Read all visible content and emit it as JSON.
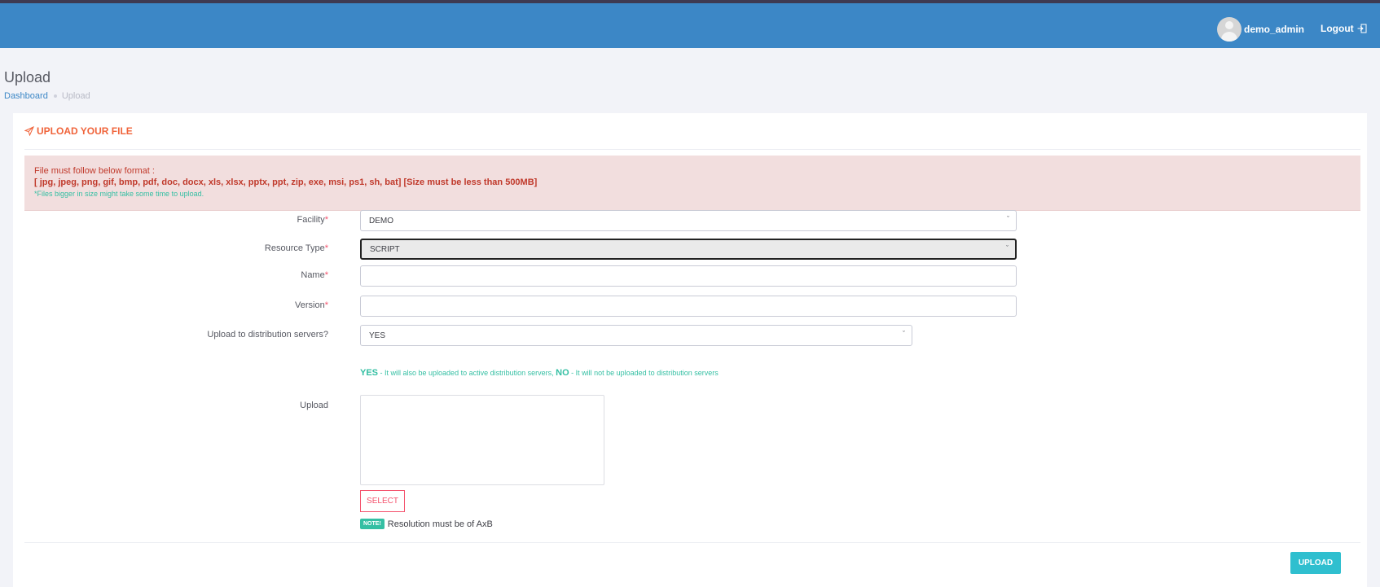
{
  "header": {
    "username": "demo_admin",
    "logout_label": "Logout"
  },
  "page": {
    "title": "Upload",
    "breadcrumb": [
      "Dashboard",
      "Upload"
    ]
  },
  "card": {
    "title": "UPLOAD YOUR FILE",
    "alert": {
      "line1": "File must follow below format :",
      "line2": "[ jpg, jpeg, png, gif, bmp, pdf, doc, docx, xls, xlsx, pptx, ppt, zip, exe, msi, ps1, sh, bat] [Size must be less than 500MB]",
      "line3": "*Files bigger in size might take some time to upload."
    },
    "form": {
      "facility": {
        "label": "Facility",
        "required": "*",
        "value": "DEMO"
      },
      "resource_type": {
        "label": "Resource Type",
        "required": "*",
        "value": "SCRIPT"
      },
      "name": {
        "label": "Name",
        "required": "*",
        "value": ""
      },
      "version": {
        "label": "Version",
        "required": "*",
        "value": ""
      },
      "distribution": {
        "label": "Upload to distribution servers?",
        "value": "YES",
        "hint_yes": "YES",
        "hint_yes_text": " - It will also be uploaded to active distribution servers, ",
        "hint_no": "NO",
        "hint_no_text": " - It will not be uploaded to distribution servers"
      },
      "upload": {
        "label": "Upload"
      },
      "select_button": "SELECT",
      "note_badge": "NOTE!",
      "note_text": "Resolution must be of AxB"
    },
    "submit_label": "UPLOAD"
  },
  "colors": {
    "header": "#3c87c6",
    "accent_orange": "#f0643b",
    "alert_bg": "#f2dede",
    "danger": "#f4516c",
    "success": "#34bfa3",
    "upload_button": "#2fbfcf"
  },
  "icons": {
    "card_title": "send-icon",
    "logout": "logout-icon",
    "chevron": "chevron-down-icon"
  }
}
